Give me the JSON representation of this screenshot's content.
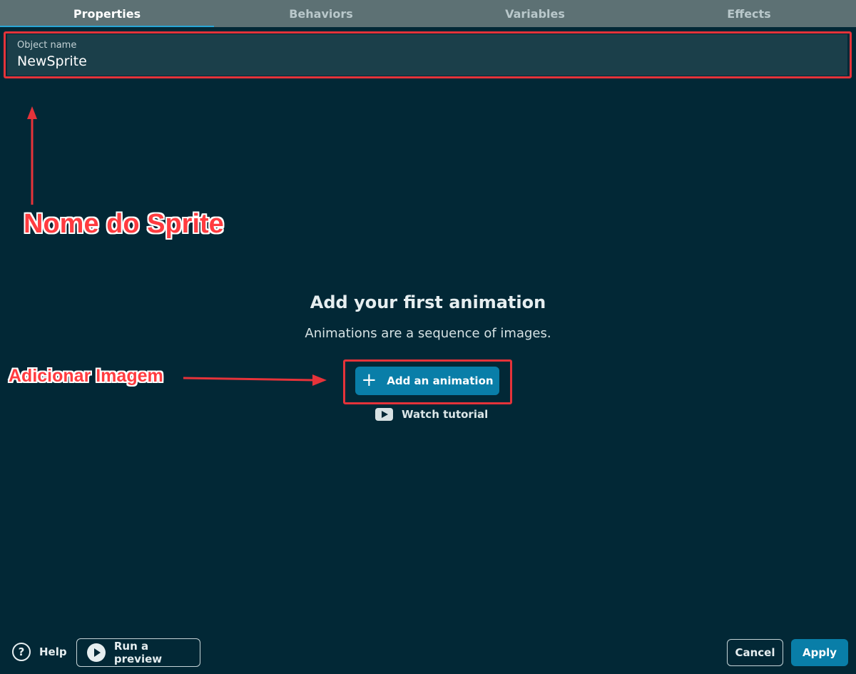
{
  "tabs": [
    {
      "label": "Properties",
      "active": true
    },
    {
      "label": "Behaviors",
      "active": false
    },
    {
      "label": "Variables",
      "active": false
    },
    {
      "label": "Effects",
      "active": false
    }
  ],
  "object_name": {
    "label": "Object name",
    "value": "NewSprite"
  },
  "empty_state": {
    "title": "Add your first animation",
    "subtitle": "Animations are a sequence of images.",
    "add_button_label": "Add an animation",
    "add_button_icon": "plus-icon",
    "tutorial_label": "Watch tutorial",
    "tutorial_icon": "youtube-icon"
  },
  "annotations": {
    "sprite_name_label": "Nome do Sprite",
    "add_image_label": "Adicionar Imagem",
    "color": "#e5333a"
  },
  "footer": {
    "help_label": "Help",
    "help_icon": "question-icon",
    "preview_label": "Run a preview",
    "preview_icon": "play-icon",
    "cancel_label": "Cancel",
    "apply_label": "Apply"
  },
  "colors": {
    "background": "#022836",
    "tabbar": "#5d7174",
    "accent": "#097ea8",
    "field": "#1b3f4a"
  }
}
